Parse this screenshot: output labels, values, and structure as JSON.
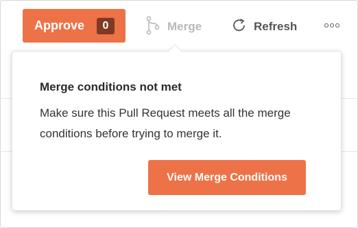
{
  "toolbar": {
    "approve_label": "Approve",
    "approve_count": "0",
    "merge_label": "Merge",
    "refresh_label": "Refresh",
    "merge_icon": "git-merge-icon",
    "refresh_icon": "refresh-icon",
    "more_icon": "more-horizontal-icon"
  },
  "popover": {
    "title": "Merge conditions not met",
    "body": "Make sure this Pull Request meets all the merge conditions before trying to merge it.",
    "button_label": "View Merge Conditions"
  },
  "colors": {
    "accent": "#ee7248",
    "count_badge": "#7e3a22",
    "disabled_text": "#b9b9b9"
  }
}
